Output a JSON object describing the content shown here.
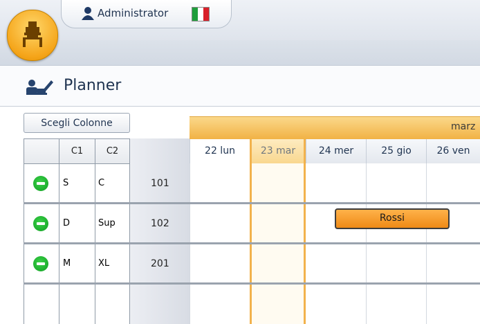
{
  "header": {
    "user_name": "Administrator",
    "flag_colors": [
      "#1f9e3c",
      "#ffffff",
      "#d8202a"
    ]
  },
  "page": {
    "title": "Planner"
  },
  "toolbar": {
    "choose_columns_label": "Scegli Colonne"
  },
  "left_grid": {
    "columns": [
      "C1",
      "C2"
    ],
    "rows": [
      {
        "c1": "S",
        "c2": "C",
        "room": "101",
        "status_color": "#14a82a"
      },
      {
        "c1": "D",
        "c2": "Sup",
        "room": "102",
        "status_color": "#14a82a"
      },
      {
        "c1": "M",
        "c2": "XL",
        "room": "201",
        "status_color": "#14a82a"
      }
    ]
  },
  "calendar": {
    "month_label": "marz",
    "days": [
      "22 lun",
      "23 mar",
      "24 mer",
      "25 gio",
      "26 ven"
    ],
    "today": "23 mar",
    "bookings": [
      {
        "guest": "Rossi",
        "room": "102"
      }
    ]
  },
  "colors": {
    "accent_orange": "#f2a737",
    "status_green": "#14a82a"
  }
}
